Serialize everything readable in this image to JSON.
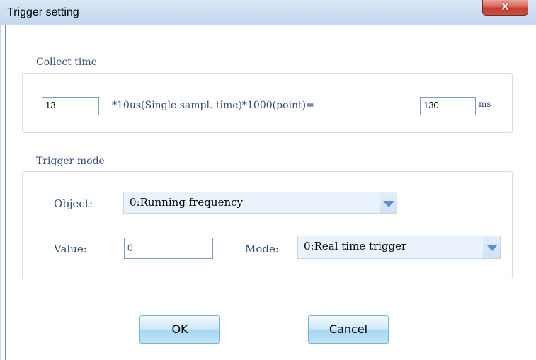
{
  "window": {
    "title": "Trigger setting",
    "close_label": "X"
  },
  "collect_time": {
    "legend": "Collect time",
    "multiplier_value": "13",
    "formula_text": "*10us(Single sampl. time)*1000(point)=",
    "result_value": "130",
    "unit": "ms"
  },
  "trigger_mode": {
    "legend": "Trigger mode",
    "object_label": "Object:",
    "object_selected": "0:Running frequency",
    "value_label": "Value:",
    "value_input": "0",
    "mode_label": "Mode:",
    "mode_selected": "0:Real time trigger"
  },
  "buttons": {
    "ok": "OK",
    "cancel": "Cancel"
  }
}
